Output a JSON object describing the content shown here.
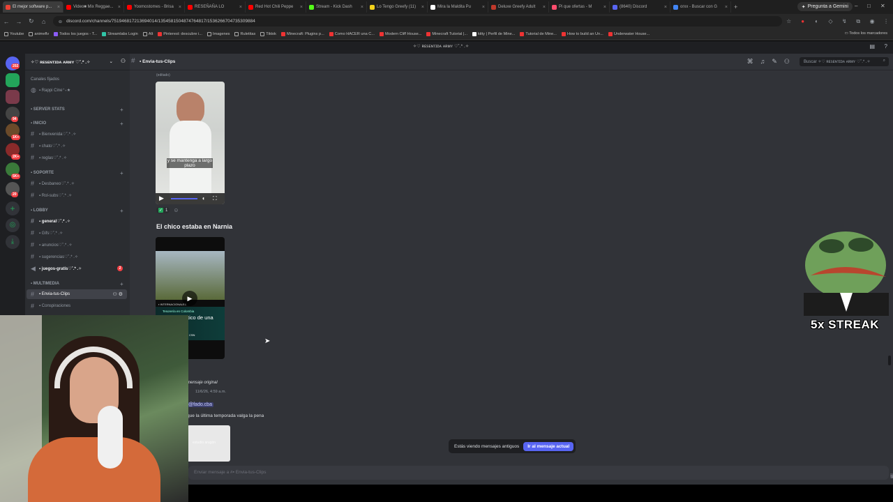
{
  "browser": {
    "tabs": [
      {
        "title": "El mejor software p...",
        "color": "#ea4335"
      },
      {
        "title": "Video■ Mix Reggae...",
        "color": "#ff0000"
      },
      {
        "title": "Yoomostomes - Brisa",
        "color": "#ff0000"
      },
      {
        "title": "RESEÑAÑA LO",
        "color": "#ff0000"
      },
      {
        "title": "Red Hot Chili Peppe",
        "color": "#ff0000"
      },
      {
        "title": "Stream - Kick Dash",
        "color": "#53fc18"
      },
      {
        "title": "Lo Tengo Greefy (11)",
        "color": "#f2d21b"
      },
      {
        "title": "Mira la Maldita Pu",
        "color": "#ffffff"
      },
      {
        "title": "Deluxe Greefy Adult",
        "color": "#c0392b"
      },
      {
        "title": "Pi que ofertas - M",
        "color": "#ff4d6d"
      },
      {
        "title": "(8640) Discord",
        "color": "#5865f2"
      },
      {
        "title": "orxx - Buscar con G",
        "color": "#4285f4"
      }
    ],
    "gemini": "Pregunta a Gemini",
    "url": "discord.com/channels/751946817213694014/1354581504874764817/1536266704735309884",
    "bookmarks": [
      "Youtube",
      "animeflv",
      "Todos los juegos - T...",
      "Streamlabs Login",
      "Alt",
      "Pinterest: descubre i...",
      "Imagenes",
      "Ruletitas",
      "Tiktok",
      "Minecraft: Plugins p...",
      "Como HACER una C...",
      "Modern Cliff House...",
      "Minecraft Tutorial |...",
      "kitty | Perfil de Mine...",
      "Tutorial de Mine...",
      "How to build an Un...",
      "Underwater House..."
    ],
    "all_bookmarks": "Todos los marcadores"
  },
  "discord": {
    "window_title": "✧♡ ʀᴇsᴇɴᴛɪᴅᴀ ᴀʀᴍʏ ♡˚.* .✧",
    "server_name": "✧♡ ʀᴇsᴇɴᴛɪᴅᴀ ᴀʀᴍʏ ♡˚.* .✧",
    "guild_badges": [
      "202",
      "94",
      "1K+",
      "2K+",
      "5K+",
      "20"
    ],
    "pinned_label": "Canales fijados",
    "pinned_channel": "▪ Rappi Cine⁺₊★",
    "categories": [
      {
        "name": "▪ SERVER STATS",
        "channels": []
      },
      {
        "name": "▪ INICIO",
        "channels": [
          "▪ Bienvenida♡˚.* .✧",
          "▪ chato♡˚.* .✧",
          "▪ reglas♡˚.* .✧"
        ]
      },
      {
        "name": "▪ SOPORTE",
        "channels": [
          "▪ Desbaneo♡˚.* .✧",
          "▪ Rol-subs♡˚.* .✧"
        ]
      },
      {
        "name": "▪ LOBBY",
        "channels": [
          "▪ general♡˚.* .✧",
          "▪ Gifs♡˚.* .✧",
          "▪ anuncios♡˚.* .✧",
          "▪ sugerencias♡˚.* .✧",
          "▪ juegos-gratis♡˚.* .✧"
        ]
      },
      {
        "name": "▪ MULTIMEDIA",
        "channels": [
          "▪ Envia-tus-Clips",
          "▪ Conspiraciones"
        ]
      }
    ],
    "juegos_badge": "2",
    "current_channel": "▪ Envia-tus-Clips",
    "search_placeholder": "Buscar ✧♡ ʀᴇsᴇɴᴛɪᴅᴀ ᴀʀᴍʏ ♡˚.* .✧",
    "edited_tag": "(editado)",
    "video1_caption": "y se mantenga a largo plazo",
    "reaction_count": "1",
    "message_text": "El chico estaba en Narnia",
    "video2_overlay_title": "▪ INTERNACIONALES",
    "video2_overlay_sub": "Tesorería en Colombia",
    "video2_overlay_big": "tico de una",
    "video2_overlay_small": "CSN",
    "forwarded_label": "mensaje original",
    "forwarded_meta": "11/6/26, 4:59 a.m.",
    "mention": "@fado.cba",
    "quote_text": "que la última temporada valga la pena",
    "thumb_label": "estudio aragón",
    "old_messages_notice": "Estás viendo mensajes antiguos",
    "jump_button": "Ir al mensaje actual",
    "composer_placeholder": "Enviar mensaje a #▪ Envia-tus-Clips"
  },
  "overlay": {
    "streak": "5x STREAK"
  },
  "colors": {
    "discord_bg": "#313338",
    "sidebar_bg": "#2b2d31",
    "blurple": "#5865f2"
  }
}
